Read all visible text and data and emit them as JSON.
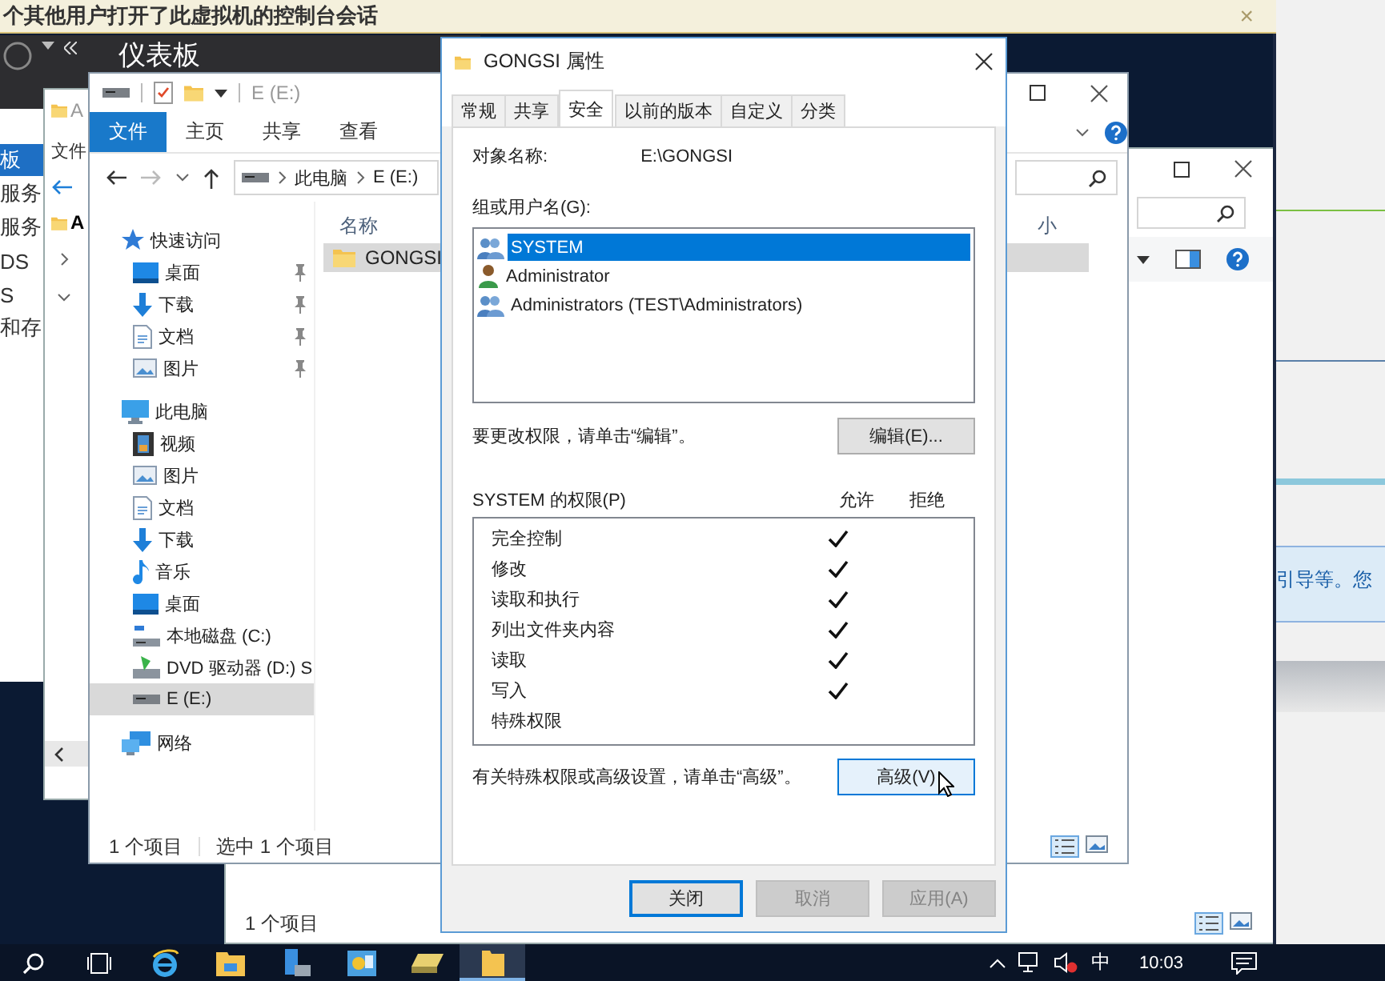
{
  "banner": {
    "text": "个其他用户打开了此虚拟机的控制台会话",
    "close": "×"
  },
  "side_app": {
    "text": "引导等。您"
  },
  "server_manager": {
    "title": "仪表板",
    "nav": [
      {
        "label": "板",
        "selected": true
      },
      {
        "label": "服务",
        "selected": false
      },
      {
        "label": "服务",
        "selected": false
      },
      {
        "label": "DS",
        "selected": false
      },
      {
        "label": "S",
        "selected": false
      },
      {
        "label": "和存",
        "selected": false
      }
    ]
  },
  "explorer_back": {
    "title": "A",
    "ribbon_tab": "文件",
    "tree_item": "A"
  },
  "explorer_behind": {
    "status": "1 个项目"
  },
  "explorer": {
    "title": "E (E:)",
    "ribbon_tabs": [
      {
        "label": "文件",
        "selected": true
      },
      {
        "label": "主页",
        "selected": false
      },
      {
        "label": "共享",
        "selected": false
      },
      {
        "label": "查看",
        "selected": false
      }
    ],
    "path": [
      "此电脑",
      "E (E:)"
    ],
    "nav": [
      {
        "label": "快速访问",
        "kind": "quick",
        "selected": false,
        "children": [
          {
            "label": "桌面",
            "kind": "desktop",
            "pinned": true,
            "selected": false
          },
          {
            "label": "下载",
            "kind": "download",
            "pinned": true,
            "selected": false
          },
          {
            "label": "文档",
            "kind": "document",
            "pinned": true,
            "selected": false
          },
          {
            "label": "图片",
            "kind": "picture",
            "pinned": true,
            "selected": false
          }
        ]
      },
      {
        "label": "此电脑",
        "kind": "pc",
        "selected": false,
        "children": [
          {
            "label": "视频",
            "kind": "video",
            "selected": false
          },
          {
            "label": "图片",
            "kind": "picture",
            "selected": false
          },
          {
            "label": "文档",
            "kind": "document",
            "selected": false
          },
          {
            "label": "下载",
            "kind": "download",
            "selected": false
          },
          {
            "label": "音乐",
            "kind": "music",
            "selected": false
          },
          {
            "label": "桌面",
            "kind": "desktop",
            "selected": false
          },
          {
            "label": "本地磁盘 (C:)",
            "kind": "disk",
            "selected": false
          },
          {
            "label": "DVD 驱动器 (D:) S",
            "kind": "dvd",
            "selected": false
          },
          {
            "label": "E (E:)",
            "kind": "drive",
            "selected": true
          }
        ]
      },
      {
        "label": "网络",
        "kind": "network",
        "selected": false
      }
    ],
    "columns": [
      "名称",
      "小"
    ],
    "files": [
      {
        "name": "GONGSI",
        "selected": true
      }
    ],
    "status": [
      "1 个项目",
      "选中 1 个项目"
    ]
  },
  "dialog": {
    "title": "GONGSI 属性",
    "tabs": [
      {
        "label": "常规",
        "selected": false
      },
      {
        "label": "共享",
        "selected": false
      },
      {
        "label": "安全",
        "selected": true
      },
      {
        "label": "以前的版本",
        "selected": false
      },
      {
        "label": "自定义",
        "selected": false
      },
      {
        "label": "分类",
        "selected": false
      }
    ],
    "object_label": "对象名称:",
    "object_value": "E:\\GONGSI",
    "groups_label": "组或用户名(G):",
    "groups": [
      {
        "name": "SYSTEM",
        "kind": "group",
        "selected": true
      },
      {
        "name": "Administrator",
        "kind": "user",
        "selected": false
      },
      {
        "name": "Administrators (TEST\\Administrators)",
        "kind": "group",
        "selected": false
      }
    ],
    "edit_hint": "要更改权限，请单击“编辑”。",
    "edit_button": "编辑(E)...",
    "permissions_label": "SYSTEM 的权限(P)",
    "allow_header": "允许",
    "deny_header": "拒绝",
    "permissions": [
      {
        "name": "完全控制",
        "allow": true,
        "deny": false
      },
      {
        "name": "修改",
        "allow": true,
        "deny": false
      },
      {
        "name": "读取和执行",
        "allow": true,
        "deny": false
      },
      {
        "name": "列出文件夹内容",
        "allow": true,
        "deny": false
      },
      {
        "name": "读取",
        "allow": true,
        "deny": false
      },
      {
        "name": "写入",
        "allow": true,
        "deny": false
      },
      {
        "name": "特殊权限",
        "allow": false,
        "deny": false
      }
    ],
    "advanced_hint": "有关特殊权限或高级设置，请单击“高级”。",
    "advanced_button": {
      "label": "高级(V)",
      "hovered": true
    },
    "buttons": [
      {
        "label": "关闭",
        "disabled": false,
        "default": true
      },
      {
        "label": "取消",
        "disabled": true,
        "default": false
      },
      {
        "label": "应用(A)",
        "disabled": true,
        "default": false
      }
    ]
  },
  "taskbar": {
    "apps": [
      {
        "kind": "search",
        "active": false
      },
      {
        "kind": "taskview",
        "active": false
      },
      {
        "kind": "ie",
        "active": false
      },
      {
        "kind": "folder",
        "active": false
      },
      {
        "kind": "server",
        "active": false
      },
      {
        "kind": "control",
        "active": false
      },
      {
        "kind": "drive",
        "active": false
      },
      {
        "kind": "explorer",
        "active": true
      }
    ],
    "ime": "中",
    "time": "10:03"
  }
}
